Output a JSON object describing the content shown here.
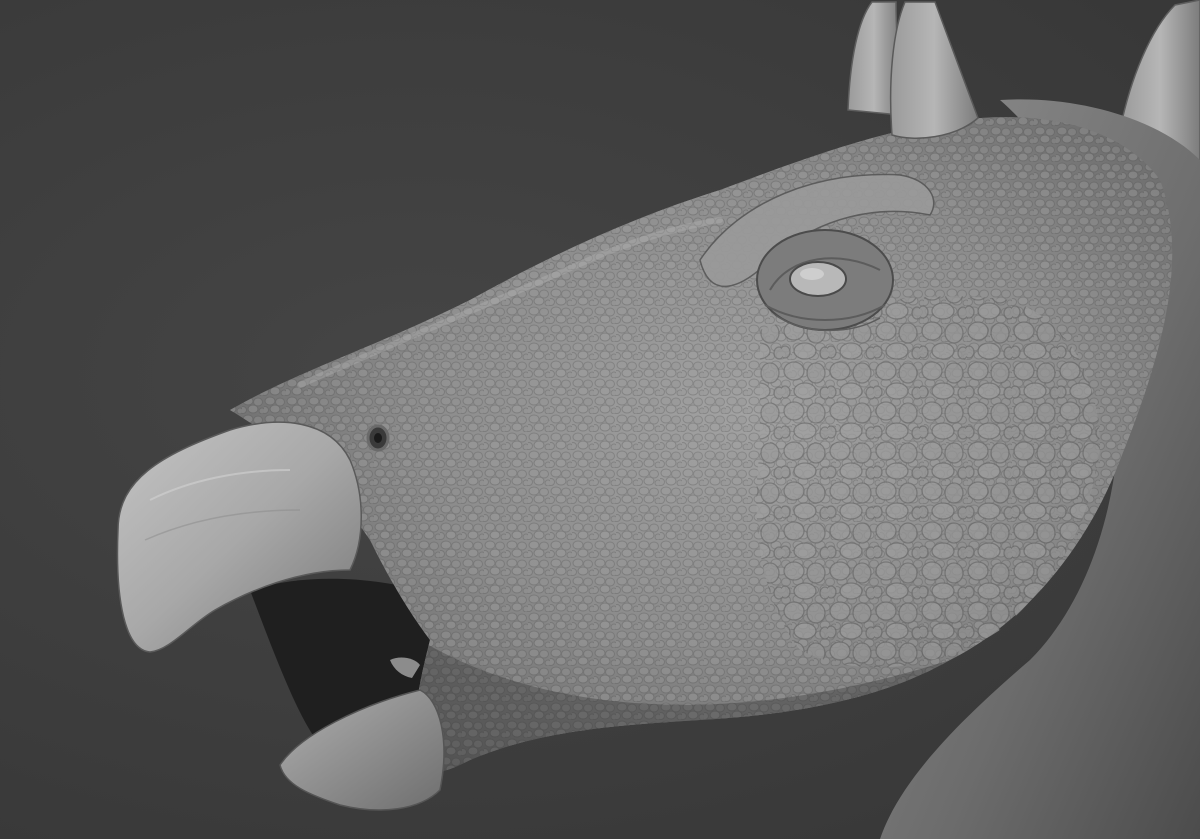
{
  "scene": {
    "subject_icon": "dinosaur-head-sculpt",
    "colors": {
      "background": "#3c3c3c",
      "clay_light": "#b4b4b4",
      "clay_mid": "#8a8a8a",
      "clay_dark": "#4e4e4e",
      "mouth_interior": "#1e1e1e"
    }
  }
}
